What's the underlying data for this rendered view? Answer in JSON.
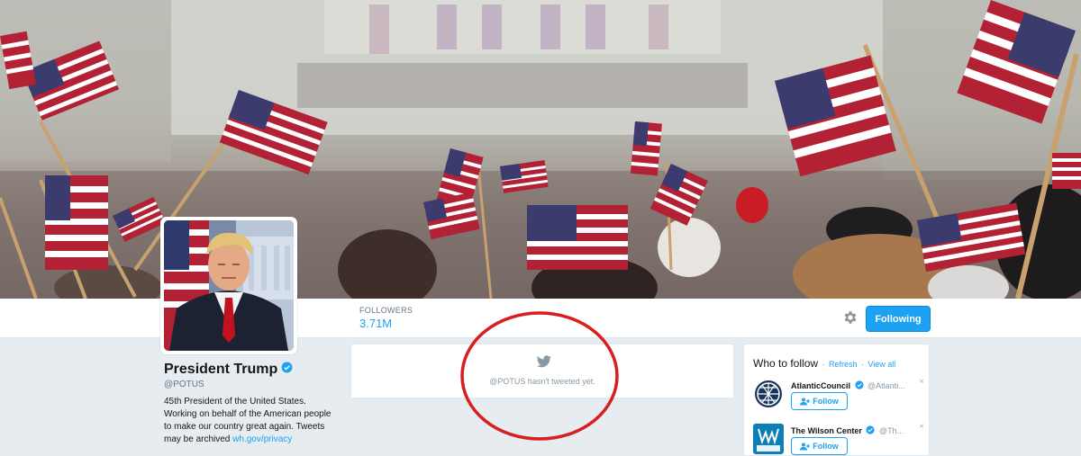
{
  "banner": {
    "description_icon": "inauguration-flags-photo"
  },
  "profile": {
    "name": "President Trump",
    "handle": "@POTUS",
    "bio_text": "45th President of the United States. Working on behalf of the American people to make our country great again. Tweets may be archived",
    "bio_link": "wh.gov/privacy",
    "verified_icon": "verified-badge-icon"
  },
  "nav": {
    "followers_label": "FOLLOWERS",
    "followers_value": "3.71M",
    "settings_icon": "gear-icon",
    "following_button": "Following"
  },
  "timeline": {
    "icon": "twitter-bird-icon",
    "empty_message": "@POTUS hasn't tweeted yet."
  },
  "who_to_follow": {
    "title": "Who to follow",
    "separator": "·",
    "refresh": "Refresh",
    "view_all": "View all",
    "suggestions": [
      {
        "name": "AtlanticCouncil",
        "handle": "@Atlanti...",
        "follow_label": "Follow",
        "dismiss": "×"
      },
      {
        "name": "The Wilson Center",
        "handle": "@Th...",
        "follow_label": "Follow",
        "dismiss": "×"
      }
    ]
  },
  "colors": {
    "accent": "#1da1f2",
    "page_bg": "#e6ecf0",
    "annotation": "#d81e1e"
  }
}
